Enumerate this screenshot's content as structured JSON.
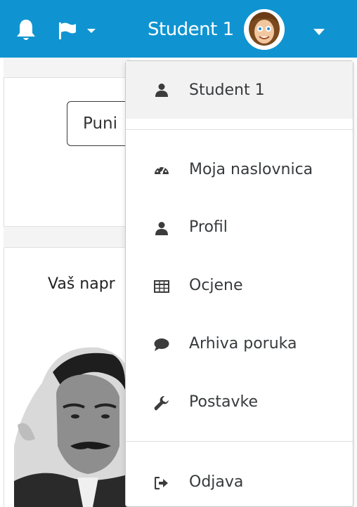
{
  "navbar": {
    "user_name": "Student 1",
    "bell_icon": "bell-icon",
    "flag_icon": "flag-icon",
    "caret_icon": "caret-down-icon",
    "color": "#0f94d1"
  },
  "page": {
    "button_label": "Puni",
    "intro_text": "Vaš napr"
  },
  "dropdown": {
    "header_item": {
      "label": "Student 1",
      "icon": "user-icon"
    },
    "items": [
      {
        "label": "Moja naslovnica",
        "icon": "dashboard-icon"
      },
      {
        "label": "Profil",
        "icon": "user-icon"
      },
      {
        "label": "Ocjene",
        "icon": "table-icon"
      },
      {
        "label": "Arhiva poruka",
        "icon": "comment-icon"
      },
      {
        "label": "Postavke",
        "icon": "wrench-icon"
      }
    ],
    "logout_item": {
      "label": "Odjava",
      "icon": "sign-out-icon"
    }
  }
}
